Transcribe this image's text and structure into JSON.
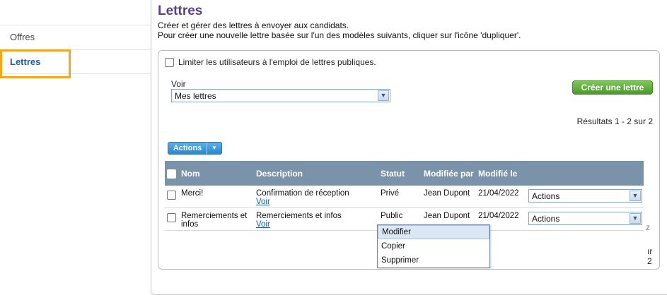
{
  "nav": {
    "items": [
      {
        "label": "Offres"
      },
      {
        "label": "Lettres"
      }
    ]
  },
  "header": {
    "title": "Lettres",
    "desc_line1": "Créer et gérer des lettres à envoyer aux candidats.",
    "desc_line2": "Pour créer une nouvelle lettre basée sur l'un des modèles suivants, cliquer sur l'icône 'dupliquer'."
  },
  "filters": {
    "limit_label": "Limiter les utilisateurs à l'emploi de lettres publiques.",
    "voir_label": "Voir",
    "voir_value": "Mes lettres"
  },
  "create_button": "Créer une lettre",
  "results_text": "Résultats 1 - 2 sur 2",
  "actions_button": "Actions",
  "table": {
    "headers": {
      "name": "Nom",
      "description": "Description",
      "status": "Statut",
      "modified_by": "Modifiée par",
      "modified_on": "Modifié le"
    },
    "rows": [
      {
        "name": "Merci!",
        "name2": "",
        "description": "Confirmation de réception",
        "link": "Voir",
        "status": "Privé",
        "modified_by": "Jean Dupont",
        "modified_on": "21/04/2022",
        "action": "Actions"
      },
      {
        "name": "Remerciements et",
        "name2": "infos",
        "description": "Remerciements et infos",
        "link": "Voir",
        "status": "Public",
        "modified_by": "Jean Dupont",
        "modified_on": "21/04/2022",
        "action": "Actions"
      }
    ]
  },
  "dropdown": {
    "items": [
      "Modifier",
      "Copier",
      "Supprimer"
    ]
  },
  "partial_text": "ır 2",
  "partial_text2": "z"
}
